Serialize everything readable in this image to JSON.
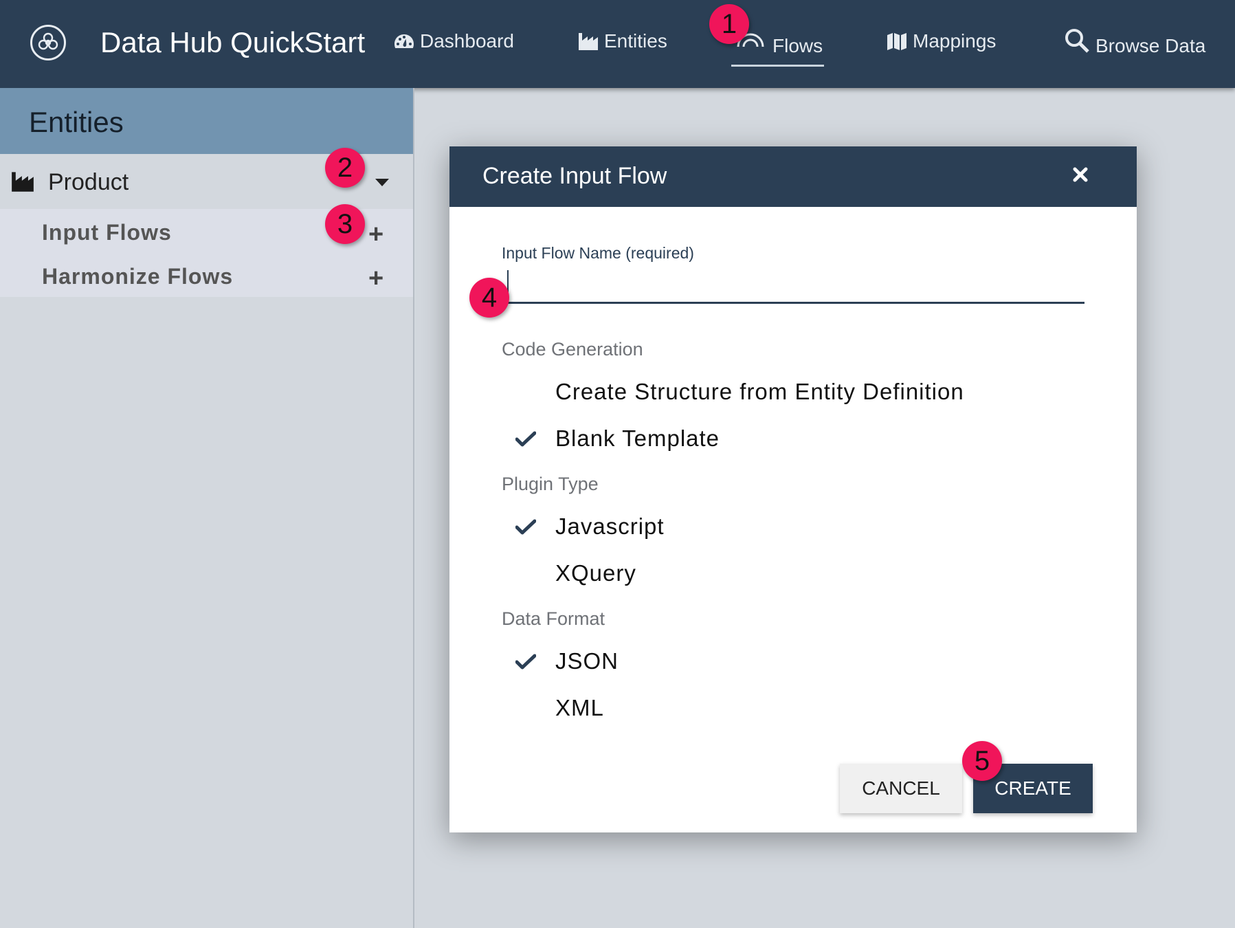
{
  "app": {
    "title": "Data Hub QuickStart"
  },
  "nav": {
    "dashboard": "Dashboard",
    "entities": "Entities",
    "flows": "Flows",
    "mappings": "Mappings",
    "browse": "Browse Data"
  },
  "sidebar": {
    "header": "Entities",
    "entity": "Product",
    "input_flows": "Input Flows",
    "harmonize_flows": "Harmonize Flows"
  },
  "modal": {
    "title": "Create Input Flow",
    "field_label": "Input Flow Name (required)",
    "field_value": "",
    "code_generation": {
      "label": "Code Generation",
      "options": [
        "Create Structure from Entity Definition",
        "Blank Template"
      ],
      "selected": "Blank Template"
    },
    "plugin_type": {
      "label": "Plugin Type",
      "options": [
        "Javascript",
        "XQuery"
      ],
      "selected": "Javascript"
    },
    "data_format": {
      "label": "Data Format",
      "options": [
        "JSON",
        "XML"
      ],
      "selected": "JSON"
    },
    "cancel_label": "CANCEL",
    "create_label": "CREATE"
  },
  "markers": [
    "1",
    "2",
    "3",
    "4",
    "5"
  ],
  "colors": {
    "navbar": "#2b3f55",
    "sidebar_header": "#7294b0",
    "marker": "#f0155a"
  }
}
